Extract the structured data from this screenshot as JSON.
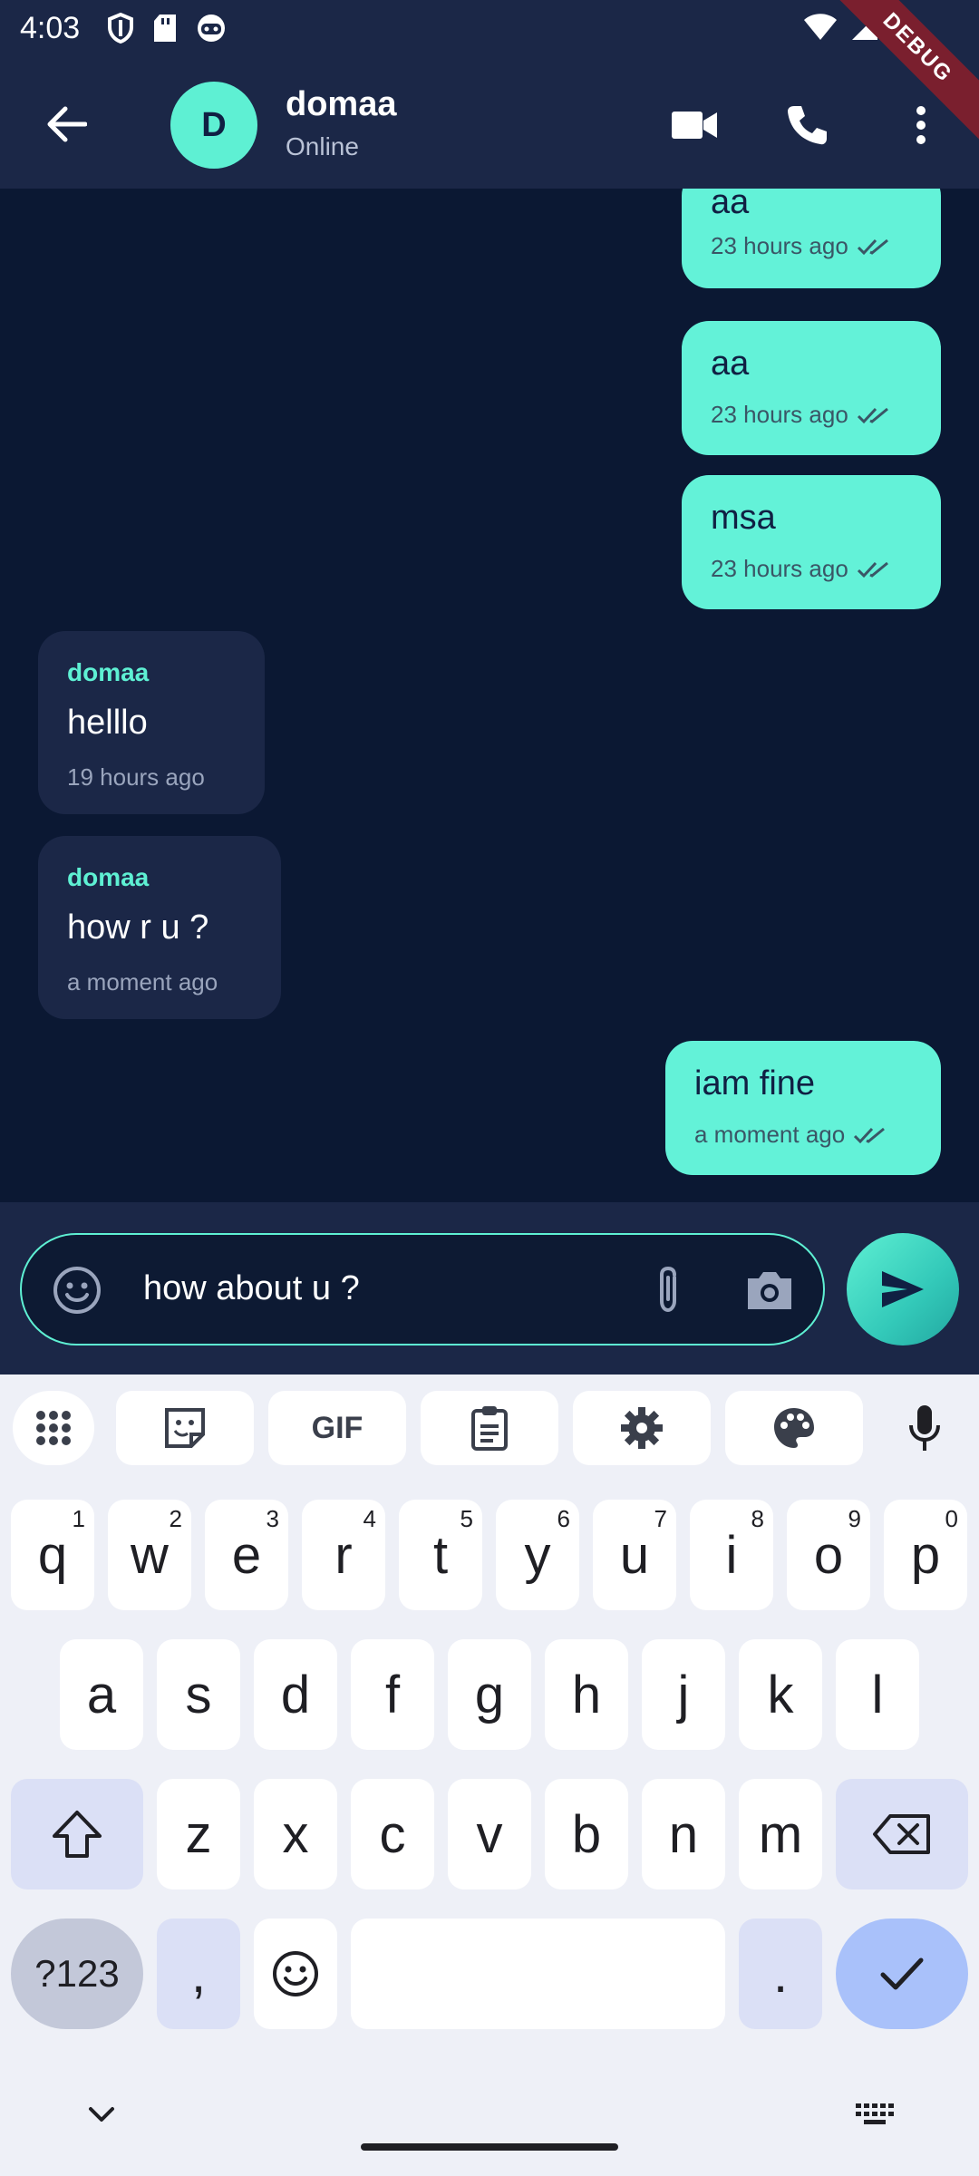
{
  "status_bar": {
    "time": "4:03",
    "icons_left": [
      "shield-icon",
      "sd-card-icon",
      "robot-face-icon"
    ],
    "icons_right": [
      "wifi-icon",
      "signal-icon"
    ],
    "debug_label": "DEBUG"
  },
  "header": {
    "avatar_initial": "D",
    "contact_name": "domaa",
    "contact_status": "Online",
    "actions": [
      "back-arrow-icon",
      "video-call-icon",
      "phone-icon",
      "more-vert-icon"
    ]
  },
  "messages": [
    {
      "direction": "out",
      "text": "aa",
      "time": "23 hours ago",
      "read": true
    },
    {
      "direction": "out",
      "text": "aa",
      "time": "23 hours ago",
      "read": true
    },
    {
      "direction": "out",
      "text": "msa",
      "time": "23 hours ago",
      "read": true
    },
    {
      "direction": "in",
      "sender": "domaa",
      "text": "helllo",
      "time": "19 hours ago"
    },
    {
      "direction": "in",
      "sender": "domaa",
      "text": "how r u ?",
      "time": "a moment ago"
    },
    {
      "direction": "out",
      "text": "iam fine",
      "time": "a moment ago",
      "read": true
    }
  ],
  "composer": {
    "value": "how about u ?"
  },
  "keyboard": {
    "toolbar": [
      "apps-grid-icon",
      "sticker-icon",
      "GIF",
      "clipboard-icon",
      "settings-icon",
      "palette-icon",
      "mic-icon"
    ],
    "gif_label": "GIF",
    "row1": [
      {
        "key": "q",
        "hint": "1"
      },
      {
        "key": "w",
        "hint": "2"
      },
      {
        "key": "e",
        "hint": "3"
      },
      {
        "key": "r",
        "hint": "4"
      },
      {
        "key": "t",
        "hint": "5"
      },
      {
        "key": "y",
        "hint": "6"
      },
      {
        "key": "u",
        "hint": "7"
      },
      {
        "key": "i",
        "hint": "8"
      },
      {
        "key": "o",
        "hint": "9"
      },
      {
        "key": "p",
        "hint": "0"
      }
    ],
    "row2": [
      "a",
      "s",
      "d",
      "f",
      "g",
      "h",
      "j",
      "k",
      "l"
    ],
    "row3": [
      "z",
      "x",
      "c",
      "v",
      "b",
      "n",
      "m"
    ],
    "symbols_key": "?123",
    "comma_key": ",",
    "period_key": "."
  },
  "colors": {
    "accent": "#5ef0d3",
    "outgoing_bubble": "#63f2d8",
    "incoming_bubble": "#1b2747",
    "background": "#0b1833"
  }
}
